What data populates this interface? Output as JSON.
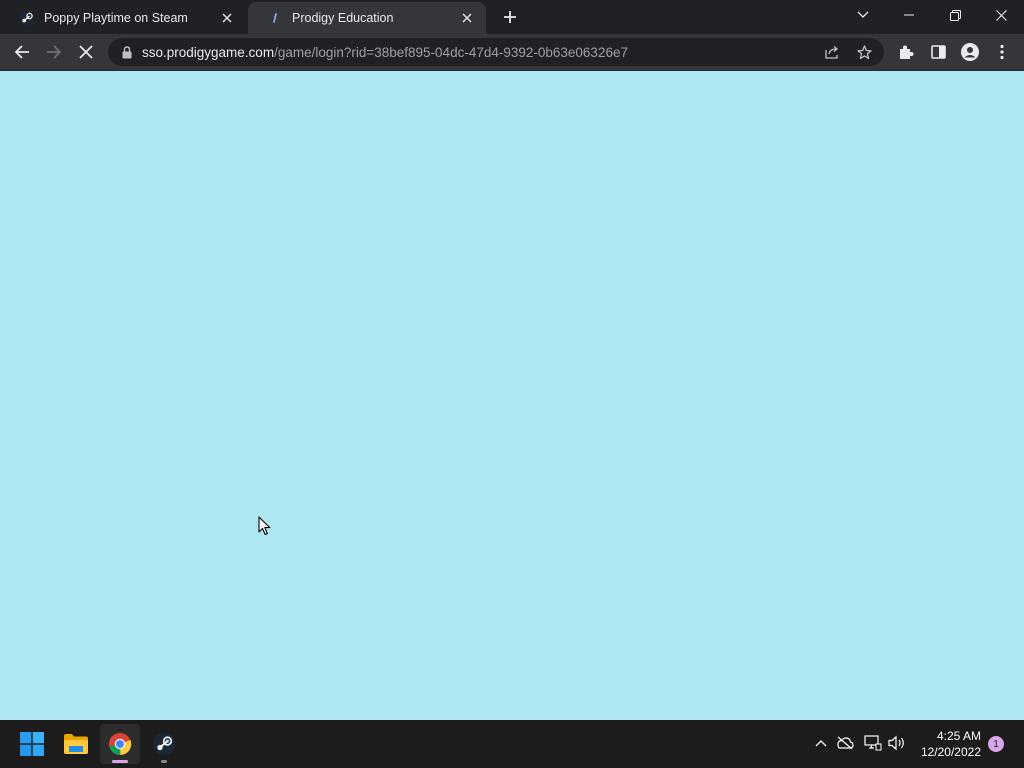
{
  "tabs": [
    {
      "title": "Poppy Playtime on Steam",
      "favicon": "steam-icon",
      "active": false
    },
    {
      "title": "Prodigy Education",
      "favicon": "prodigy-icon",
      "active": true
    }
  ],
  "address_bar": {
    "host": "sso.prodigygame.com",
    "path": "/game/login?rid=38bef895-04dc-47d4-9392-0b63e06326e7",
    "loading": true
  },
  "colors": {
    "page_background": "#aee6f2",
    "tab_strip": "#202124",
    "toolbar": "#35363a",
    "taskbar": "#1c1c1c",
    "notification_badge": "#d7a6e8"
  },
  "taskbar": {
    "apps": [
      "start-icon",
      "file-explorer-icon",
      "chrome-icon",
      "steam-icon"
    ],
    "clock": {
      "time": "4:25 AM",
      "date": "12/20/2022"
    },
    "notification_count": "1"
  }
}
